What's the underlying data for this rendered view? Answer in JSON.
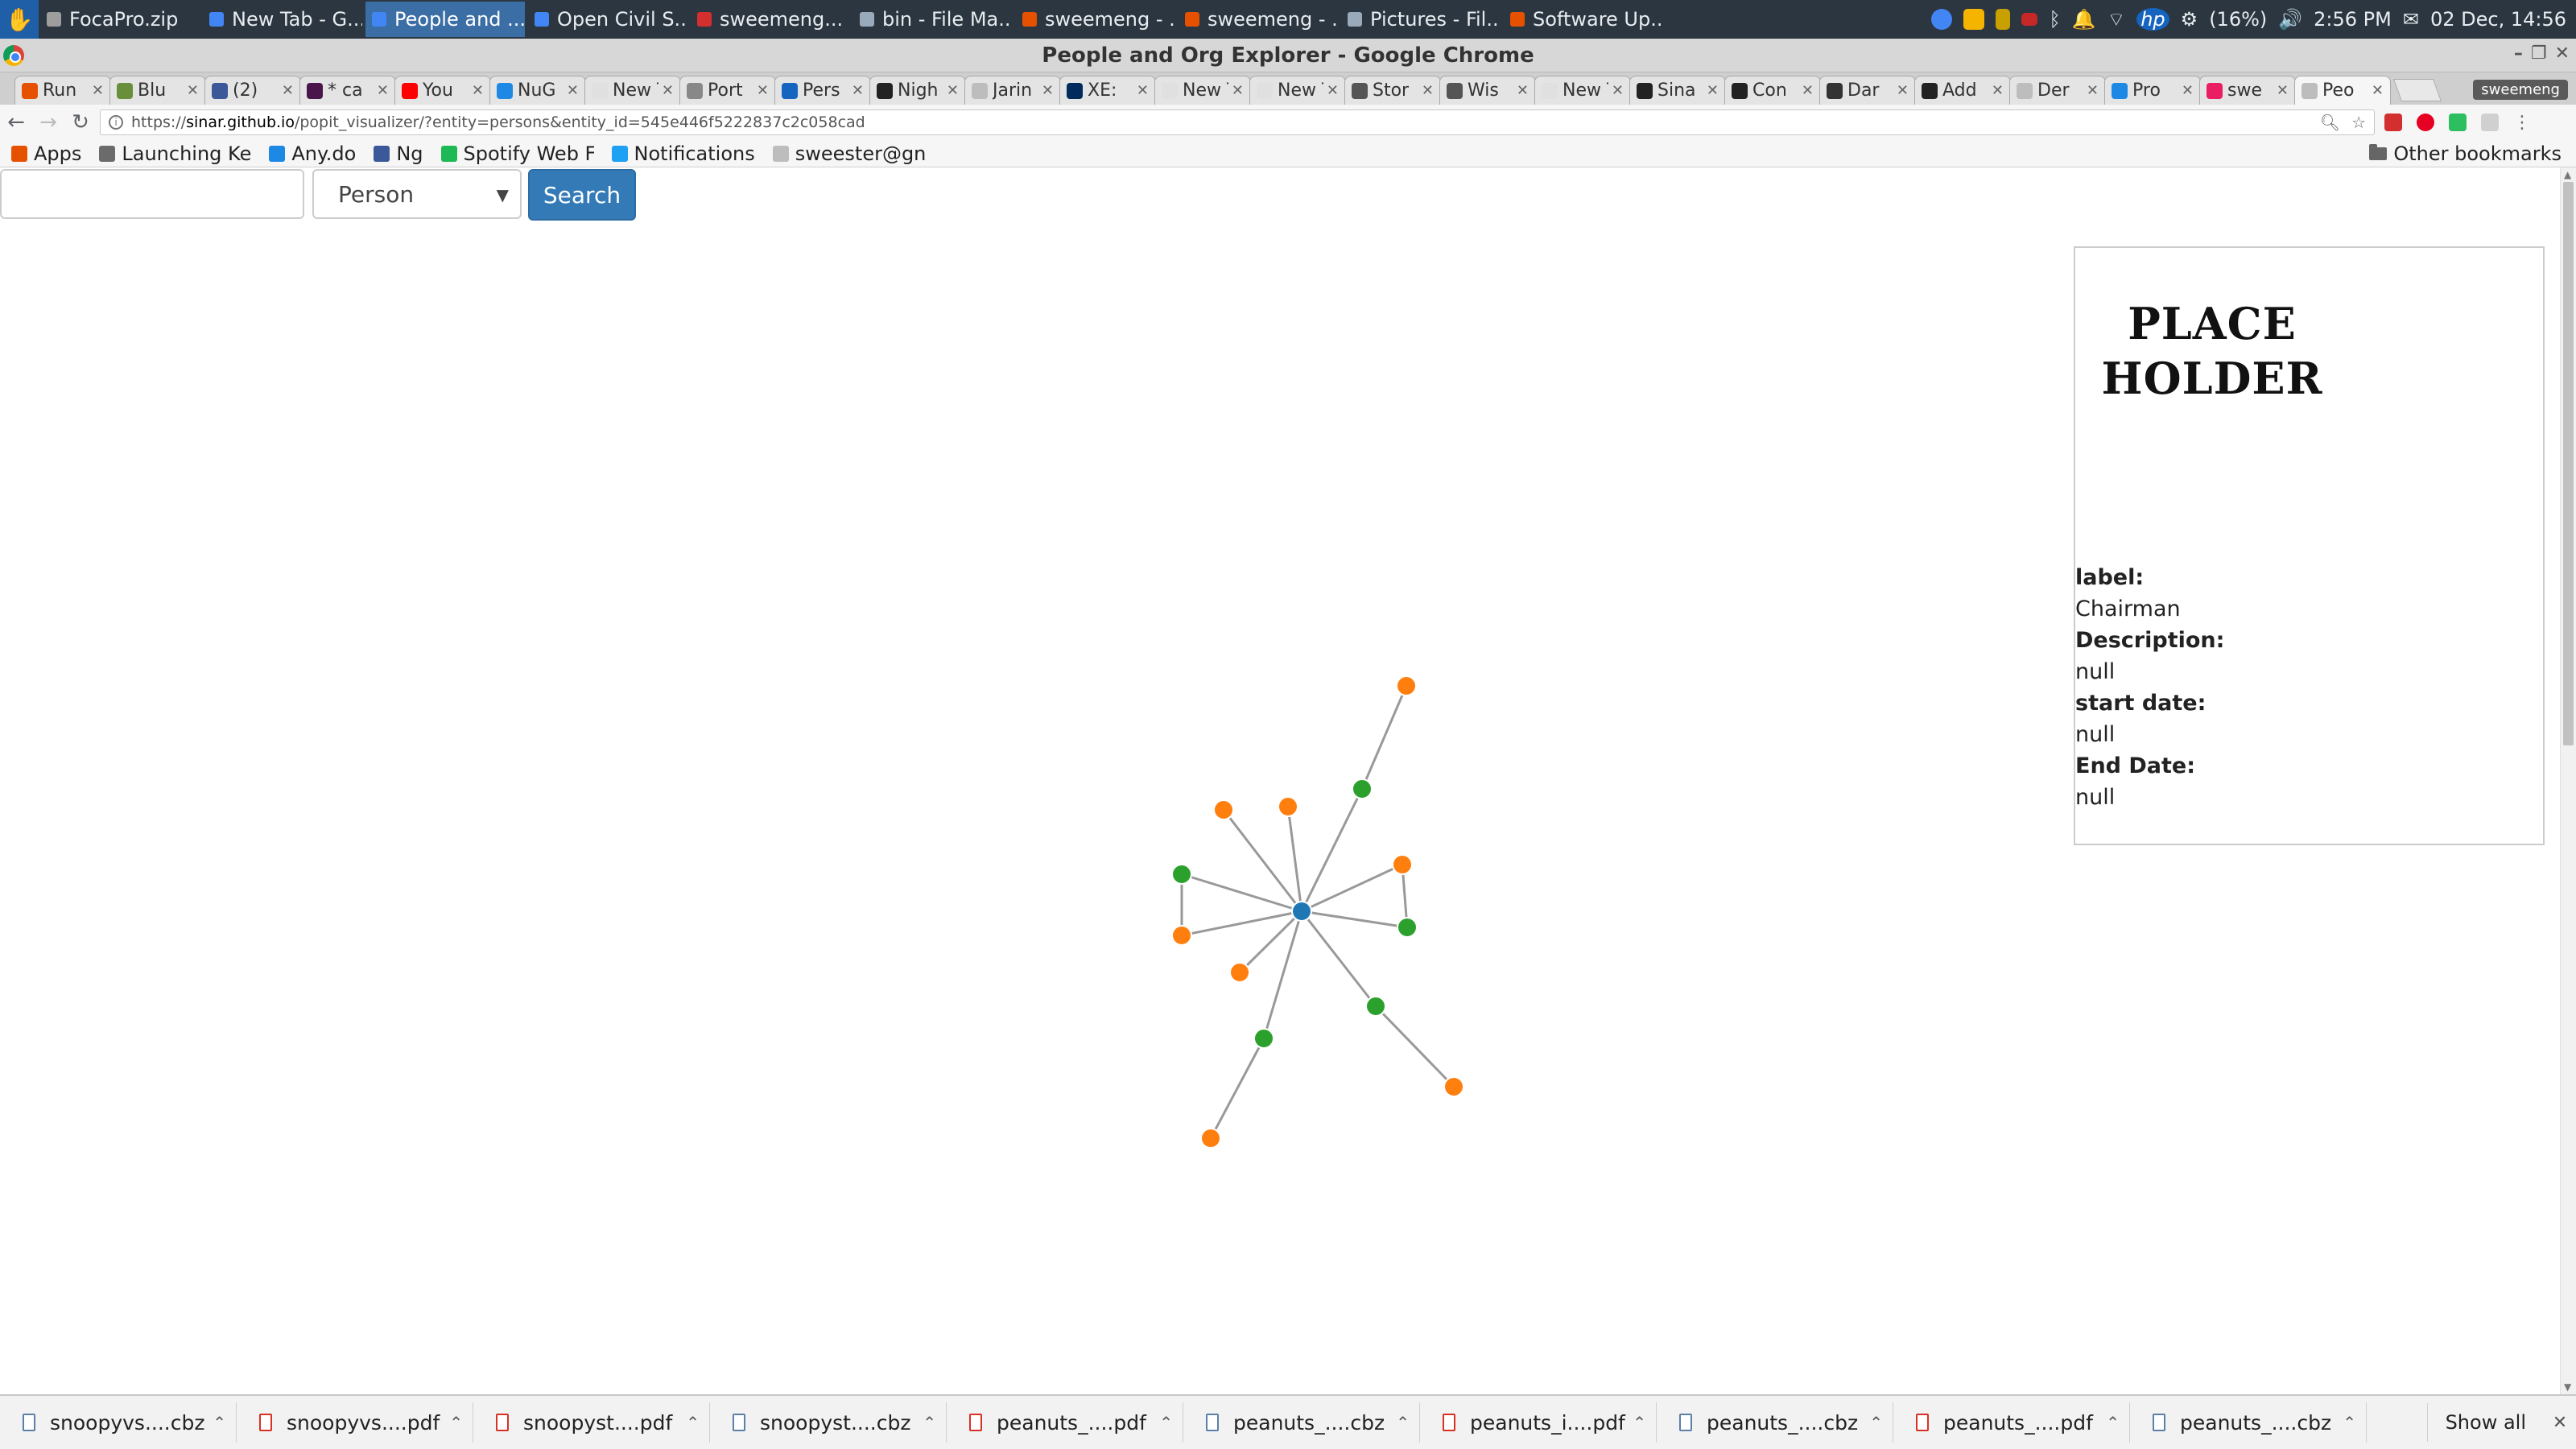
{
  "taskbar": {
    "tasks": [
      {
        "label": "FocaPro.zip",
        "color": "#9e9e9e"
      },
      {
        "label": "New Tab - G...",
        "color": "#4285f4"
      },
      {
        "label": "People and ...",
        "color": "#4285f4"
      },
      {
        "label": "Open Civil S...",
        "color": "#4285f4"
      },
      {
        "label": "sweemeng...",
        "color": "#d32f2f"
      },
      {
        "label": "bin - File Ma...",
        "color": "#9ab"
      },
      {
        "label": "sweemeng - ...",
        "color": "#e65100"
      },
      {
        "label": "sweemeng - ...",
        "color": "#e65100"
      },
      {
        "label": "Pictures - Fil...",
        "color": "#9ab"
      },
      {
        "label": "Software Up...",
        "color": "#e65100"
      }
    ],
    "active_task": 2,
    "battery": "(16%)",
    "time": "2:56 PM",
    "date": "02 Dec, 14:56"
  },
  "window": {
    "title": "People and Org Explorer - Google Chrome"
  },
  "tabs": [
    {
      "label": "Run",
      "favicon": "#e65100"
    },
    {
      "label": "Blu",
      "favicon": "#6a8f3c"
    },
    {
      "label": "(2)",
      "favicon": "#3b5998"
    },
    {
      "label": "* ca",
      "favicon": "#4a154b"
    },
    {
      "label": "You",
      "favicon": "#ff0000"
    },
    {
      "label": "NuG",
      "favicon": "#1e88e5"
    },
    {
      "label": "New T",
      "favicon": "#e0e0e0"
    },
    {
      "label": "Port",
      "favicon": "#888888"
    },
    {
      "label": "Pers",
      "favicon": "#1565c0"
    },
    {
      "label": "Nigh",
      "favicon": "#222222"
    },
    {
      "label": "Jarin",
      "favicon": "#bdbdbd"
    },
    {
      "label": "XE:",
      "favicon": "#002b5c"
    },
    {
      "label": "New T",
      "favicon": "#e0e0e0"
    },
    {
      "label": "New T",
      "favicon": "#e0e0e0"
    },
    {
      "label": "Stor",
      "favicon": "#555555"
    },
    {
      "label": "Wis",
      "favicon": "#555555"
    },
    {
      "label": "New T",
      "favicon": "#e0e0e0"
    },
    {
      "label": "Sina",
      "favicon": "#222222"
    },
    {
      "label": "Con",
      "favicon": "#222222"
    },
    {
      "label": "Dar",
      "favicon": "#333333"
    },
    {
      "label": "Add",
      "favicon": "#222222"
    },
    {
      "label": "Der",
      "favicon": "#bdbdbd"
    },
    {
      "label": "Pro",
      "favicon": "#1e88e5"
    },
    {
      "label": "swe",
      "favicon": "#e91e63"
    },
    {
      "label": "Peo",
      "favicon": "#bdbdbd"
    }
  ],
  "active_tab": 24,
  "profile": "sweemeng",
  "url": {
    "scheme": "https://",
    "host": "sinar.github.io",
    "path": "/popit_visualizer/?entity=persons&entity_id=545e446f5222837c2c058cad"
  },
  "bookmarks": [
    {
      "label": "Apps",
      "color": "#e65100"
    },
    {
      "label": "Launching Ke",
      "color": "#6b6b6b"
    },
    {
      "label": "Any.do",
      "color": "#1e88e5"
    },
    {
      "label": "Ng",
      "color": "#3b5998"
    },
    {
      "label": "Spotify Web F",
      "color": "#1db954"
    },
    {
      "label": "Notifications",
      "color": "#1da1f2"
    },
    {
      "label": "sweester@gn",
      "color": "#bdbdbd"
    }
  ],
  "other_bookmarks": "Other bookmarks",
  "search": {
    "input_value": "",
    "entity_type": "Person",
    "button_label": "Search"
  },
  "graph": {
    "colors": {
      "center": "#1f77b4",
      "membership": "#2ca02c",
      "organization": "#ff7f0e",
      "link": "#999999"
    }
  },
  "info_panel": {
    "placeholder_line1": "PLACE",
    "placeholder_line2": "HOLDER",
    "fields": [
      {
        "label": "label:",
        "value": "Chairman"
      },
      {
        "label": "Description:",
        "value": "null"
      },
      {
        "label": "start date:",
        "value": "null"
      },
      {
        "label": "End Date:",
        "value": "null"
      }
    ]
  },
  "downloads": [
    {
      "name": "snoopyvs....cbz",
      "kind": "cbz"
    },
    {
      "name": "snoopyvs....pdf",
      "kind": "pdf"
    },
    {
      "name": "snoopyst....pdf",
      "kind": "pdf"
    },
    {
      "name": "snoopyst....cbz",
      "kind": "cbz"
    },
    {
      "name": "peanuts_....pdf",
      "kind": "pdf"
    },
    {
      "name": "peanuts_....cbz",
      "kind": "cbz"
    },
    {
      "name": "peanuts_i....pdf",
      "kind": "pdf"
    },
    {
      "name": "peanuts_....cbz",
      "kind": "cbz"
    },
    {
      "name": "peanuts_....pdf",
      "kind": "pdf"
    },
    {
      "name": "peanuts_....cbz",
      "kind": "cbz"
    }
  ],
  "show_all": "Show all"
}
